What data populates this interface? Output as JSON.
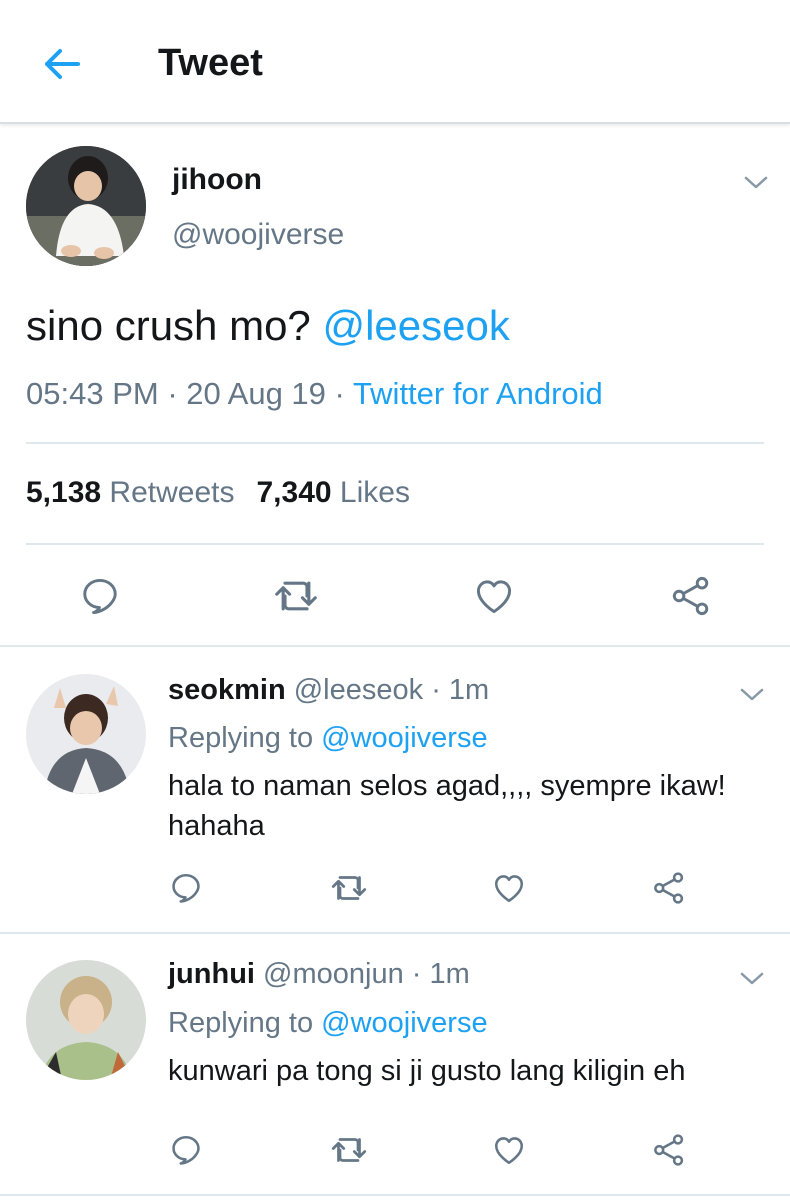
{
  "header": {
    "title": "Tweet",
    "back_icon": "back-arrow-icon",
    "accent": "#1da1f2"
  },
  "tweet": {
    "name": "jihoon",
    "handle": "@woojiverse",
    "text": "sino crush mo?",
    "mention": "@leeseok",
    "time": "05:43 PM",
    "sep": "·",
    "date": "20 Aug 19",
    "source": "Twitter for Android",
    "retweets_count": "5,138",
    "retweets_label": "Retweets",
    "likes_count": "7,340",
    "likes_label": "Likes"
  },
  "replies": [
    {
      "name": "seokmin",
      "handle": "@leeseok",
      "time": "· 1m",
      "replying_label": "Replying to",
      "replying_to": "@woojiverse",
      "text": "hala to naman selos agad,,,, syempre ikaw! hahaha"
    },
    {
      "name": "junhui",
      "handle": "@moonjun",
      "time": "· 1m",
      "replying_label": "Replying to",
      "replying_to": "@woojiverse",
      "text": "kunwari pa tong si ji gusto lang kiligin eh"
    }
  ],
  "colors": {
    "text": "#14171a",
    "secondary": "#657786",
    "link": "#1da1f2",
    "divider": "#e1e8ed"
  }
}
